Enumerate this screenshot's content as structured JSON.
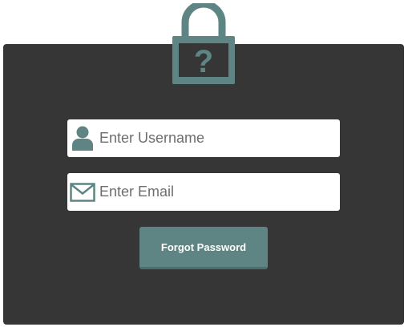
{
  "form": {
    "username_placeholder": "Enter Username",
    "email_placeholder": "Enter Email",
    "submit_label": "Forgot Password"
  },
  "icons": {
    "header": "padlock-question-icon",
    "username": "user-icon",
    "email": "envelope-icon"
  },
  "colors": {
    "accent": "#5e8583",
    "panel": "#363636",
    "field": "#ffffff"
  }
}
